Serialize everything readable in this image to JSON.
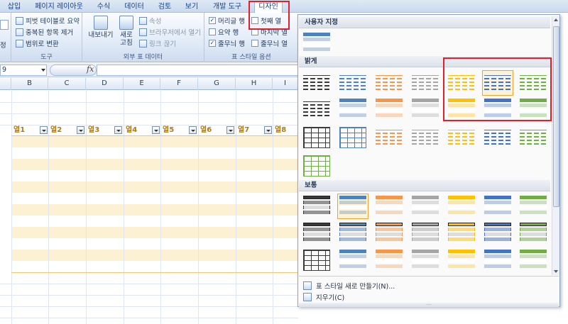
{
  "tabs": [
    {
      "label": "삽입",
      "active": false
    },
    {
      "label": "페이지 레이아웃",
      "active": false
    },
    {
      "label": "수식",
      "active": false
    },
    {
      "label": "데이터",
      "active": false
    },
    {
      "label": "검토",
      "active": false
    },
    {
      "label": "보기",
      "active": false
    },
    {
      "label": "개발 도구",
      "active": false
    },
    {
      "label": "디자인",
      "active": true
    }
  ],
  "ribbon": {
    "tools": {
      "label": "도구",
      "items": [
        "피벗 테이블로 요약",
        "중복된 항목 제거",
        "범위로 변환"
      ],
      "partial_label": "정"
    },
    "external": {
      "label": "외부 표 데이터",
      "export_label": "내보내기",
      "refresh_label_1": "새로",
      "refresh_label_2": "고침",
      "items": [
        "속성",
        "브라우저에서 열기",
        "링크 끊기"
      ]
    },
    "style_options": {
      "label": "표 스타일 옵션",
      "items": [
        {
          "label": "머리글 행",
          "checked": true
        },
        {
          "label": "첫째 열",
          "checked": false
        },
        {
          "label": "요약 행",
          "checked": false
        },
        {
          "label": "마지막 열",
          "checked": false
        },
        {
          "label": "줄무늬 행",
          "checked": true
        },
        {
          "label": "줄무늬 열",
          "checked": false
        }
      ]
    }
  },
  "formula_bar": {
    "name_box": "9",
    "fx": "fx",
    "value": ""
  },
  "columns": [
    "B",
    "C",
    "D",
    "E",
    "F",
    "G",
    "H",
    "I"
  ],
  "table_headers": [
    "열1",
    "열2",
    "열3",
    "열4",
    "열5",
    "열6",
    "열7",
    "열8"
  ],
  "gallery": {
    "sections": {
      "custom": "사용자 지정",
      "light": "밝게",
      "medium": "보통"
    },
    "menu": {
      "new_style": "표 스타일 새로 만들기(N)...",
      "clear": "지우기(C)"
    },
    "grip": "....",
    "colors": {
      "black": "#3a3a3a",
      "blue": "#4f81bd",
      "orange": "#f79646",
      "gray": "#a5a5a5",
      "gold": "#ffc000",
      "blue2": "#4472c4",
      "green": "#70ad47"
    }
  }
}
